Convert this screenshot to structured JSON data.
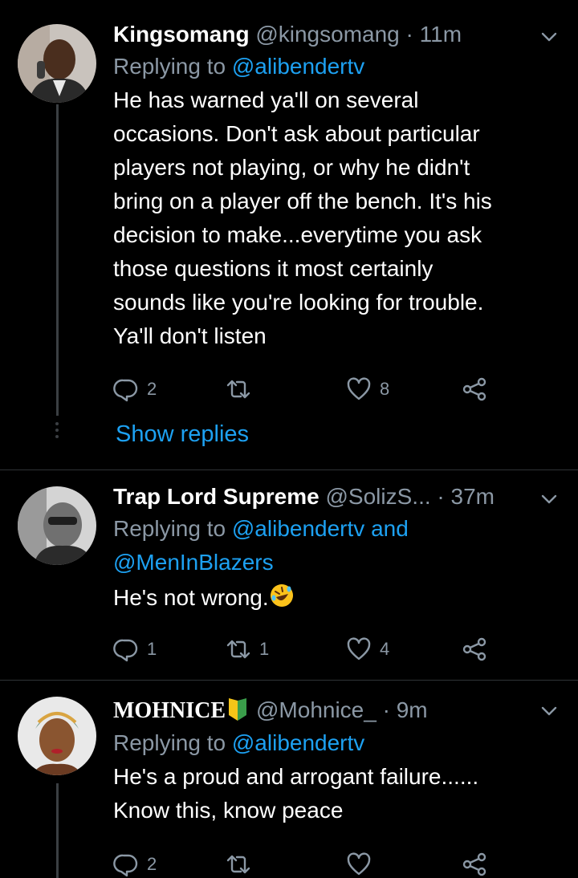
{
  "tweets": [
    {
      "name": "Kingsomang",
      "handle": "@kingsomang",
      "time": "· 11m",
      "reply_prefix": "Replying to ",
      "reply_to": [
        "@alibendertv"
      ],
      "lines": [
        "He has warned ya'll on several",
        "occasions.  Don't ask about particular",
        "players not playing, or why he didn't",
        "bring on a player off the bench. It's his",
        "decision to make...everytime you ask",
        "those questions it most certainly",
        "sounds like you're looking for trouble.",
        "Ya'll don't listen"
      ],
      "replies": "2",
      "retweets": "",
      "likes": "8",
      "show_replies": "Show replies"
    },
    {
      "name": "Trap Lord Supreme",
      "handle": "@SolizS...",
      "time": "· 37m",
      "reply_prefix": "Replying to ",
      "reply_to": [
        "@alibendertv",
        "and",
        "@MenInBlazers"
      ],
      "text": "He's not wrong.",
      "emoji": "rolling-on-floor-laughing",
      "replies": "1",
      "retweets": "1",
      "likes": "4"
    },
    {
      "name": "MOHNICE",
      "badge": "beginner-badge",
      "handle": "@Mohnice_",
      "time": "· 9m",
      "reply_prefix": "Replying to ",
      "reply_to": [
        "@alibendertv"
      ],
      "lines": [
        "He's a proud and arrogant failure......",
        "Know this, know peace"
      ],
      "replies": "2",
      "retweets": "",
      "likes": ""
    }
  ],
  "colors": {
    "background": "#000000",
    "link": "#1da1f2",
    "muted": "#8b98a5",
    "divider": "#2f3336"
  }
}
